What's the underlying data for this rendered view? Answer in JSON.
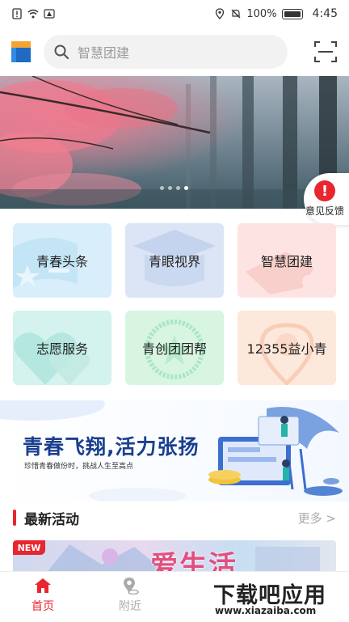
{
  "status_bar": {
    "battery": "100%",
    "time": "4:45"
  },
  "header": {
    "search_placeholder": "智慧团建",
    "logo_icon": "app-logo-icon",
    "scan_icon": "scan-icon"
  },
  "banner": {
    "dots_count": 4,
    "active_dot": 4
  },
  "feedback": {
    "label": "意见反馈",
    "icon": "exclamation-icon",
    "color": "#e8262f"
  },
  "tiles": [
    {
      "label": "青春头条"
    },
    {
      "label": "青眼视界"
    },
    {
      "label": "智慧团建"
    },
    {
      "label": "志愿服务"
    },
    {
      "label": "青创团团帮"
    },
    {
      "label": "12355益小青"
    }
  ],
  "promo": {
    "title": "青春飞翔,活力张扬",
    "subtitle": "珍惜青春做份时，挑战人生至高点"
  },
  "section": {
    "title": "最新活动",
    "more": "更多 >"
  },
  "activity": {
    "badge": "NEW",
    "title": "爱生活"
  },
  "nav": {
    "items": [
      {
        "label": "首页",
        "icon": "home-icon"
      },
      {
        "label": "附近",
        "icon": "location-icon"
      }
    ]
  },
  "watermark": {
    "title": "下载吧应用",
    "url": "www.xiazaiba.com"
  },
  "colors": {
    "accent": "#e8262f",
    "brand_blue": "#1a3f8f"
  }
}
